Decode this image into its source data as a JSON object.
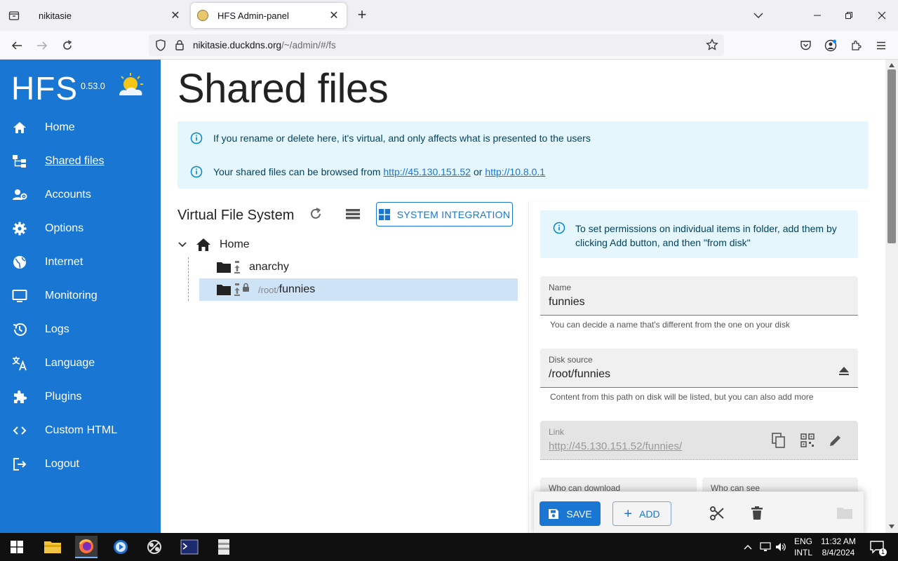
{
  "browser": {
    "tabs": [
      {
        "title": "nikitasie"
      },
      {
        "title": "HFS Admin-panel"
      }
    ],
    "url_host": "nikitasie.duckdns.org",
    "url_path": "/~/admin/#/fs"
  },
  "sidebar": {
    "logo": "HFS",
    "version": "0.53.0",
    "items": [
      {
        "label": "Home",
        "icon": "home-icon"
      },
      {
        "label": "Shared files",
        "icon": "tree-icon"
      },
      {
        "label": "Accounts",
        "icon": "accounts-icon"
      },
      {
        "label": "Options",
        "icon": "gear-icon"
      },
      {
        "label": "Internet",
        "icon": "globe-icon"
      },
      {
        "label": "Monitoring",
        "icon": "monitor-icon"
      },
      {
        "label": "Logs",
        "icon": "history-icon"
      },
      {
        "label": "Language",
        "icon": "translate-icon"
      },
      {
        "label": "Plugins",
        "icon": "puzzle-icon"
      },
      {
        "label": "Custom HTML",
        "icon": "code-icon"
      },
      {
        "label": "Logout",
        "icon": "logout-icon"
      }
    ],
    "active": "Shared files",
    "accent": "#1976d2"
  },
  "main": {
    "title": "Shared files",
    "info1": "If you rename or delete here, it's virtual, and only affects what is presented to the users",
    "info2_prefix": "Your shared files can be browsed from",
    "info2_link1": "http://45.130.151.52",
    "info2_or": "or",
    "info2_link2": "http://10.8.0.1",
    "vfs_title": "Virtual File System",
    "system_integration": "SYSTEM INTEGRATION",
    "tree": {
      "root": "Home",
      "children": [
        {
          "name": "anarchy",
          "prefix": ""
        },
        {
          "name": "funnies",
          "prefix": "/root/"
        }
      ]
    }
  },
  "panel": {
    "info": "To set permissions on individual items in folder, add them by clicking Add button, and then \"from disk\"",
    "name_label": "Name",
    "name_value": "funnies",
    "name_help": "You can decide a name that's different from the one on your disk",
    "source_label": "Disk source",
    "source_value": "/root/funnies",
    "source_help": "Content from this path on disk will be listed, but you can also add more",
    "link_label": "Link",
    "link_value": "http://45.130.151.52/funnies/",
    "who_download": "Who can download",
    "who_see": "Who can see",
    "save": "SAVE",
    "add": "ADD"
  },
  "taskbar": {
    "lang1": "ENG",
    "lang2": "INTL",
    "time": "11:32 AM",
    "date": "8/4/2024",
    "notif": "1"
  }
}
